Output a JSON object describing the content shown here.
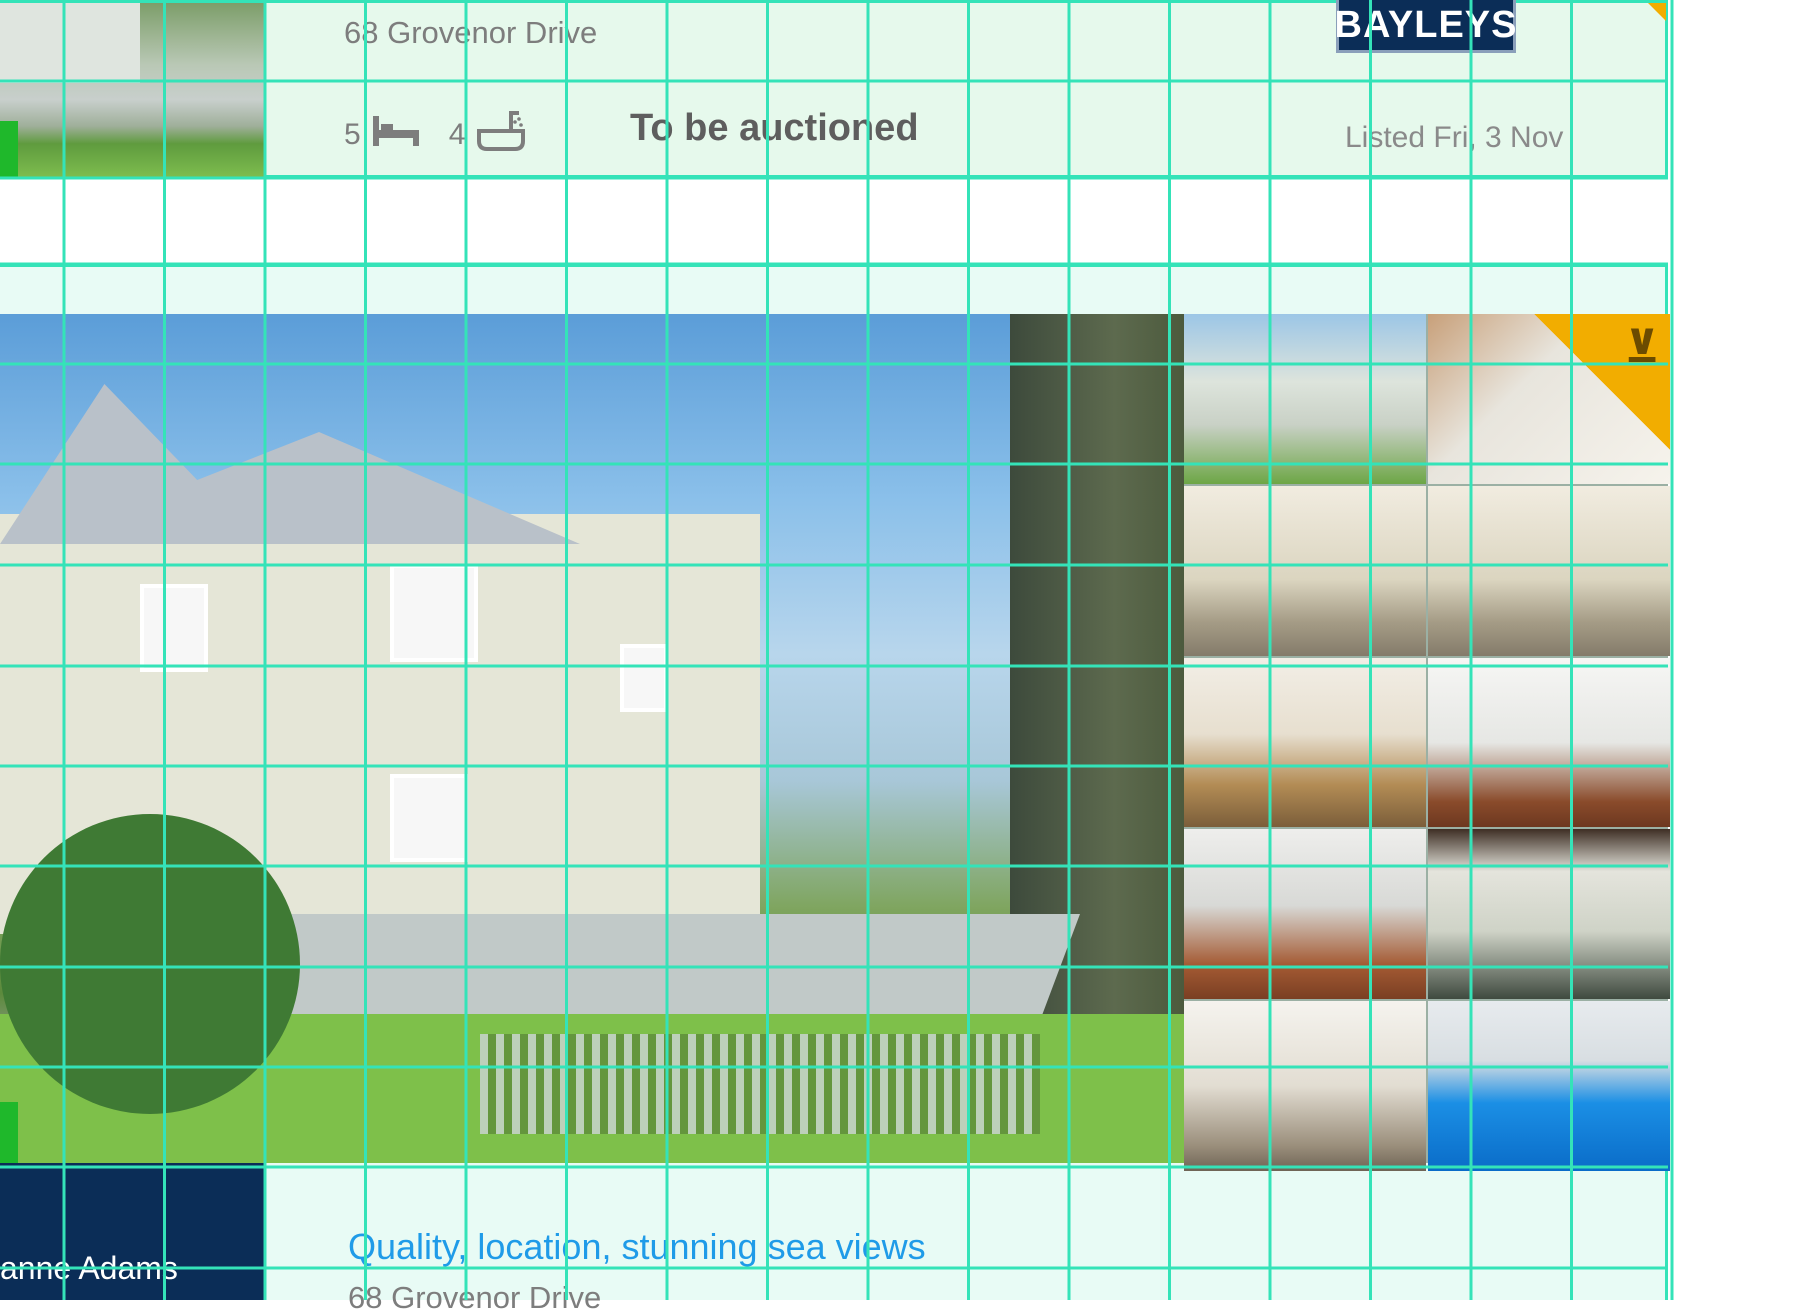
{
  "listing_1": {
    "address": "68 Grovenor Drive",
    "bedrooms": "5",
    "bathrooms": "4",
    "status": "To be auctioned",
    "agency_logo": "BAYLEYS",
    "listed": "Listed Fri, 3 Nov",
    "icons": [
      "bed-icon",
      "bath-icon"
    ]
  },
  "listing_2": {
    "agent_name": "anne Adams",
    "headline": "Quality, location, stunning sea views",
    "address": "68 Grovenor Drive",
    "badge_icon": "agency-badge-icon",
    "badge_text": "⊻"
  },
  "colors": {
    "grid_overlay": "#34e3b8",
    "headline": "#1f9be8",
    "agency_navy": "#0b2d57",
    "accent_gold": "#f2ad00"
  }
}
